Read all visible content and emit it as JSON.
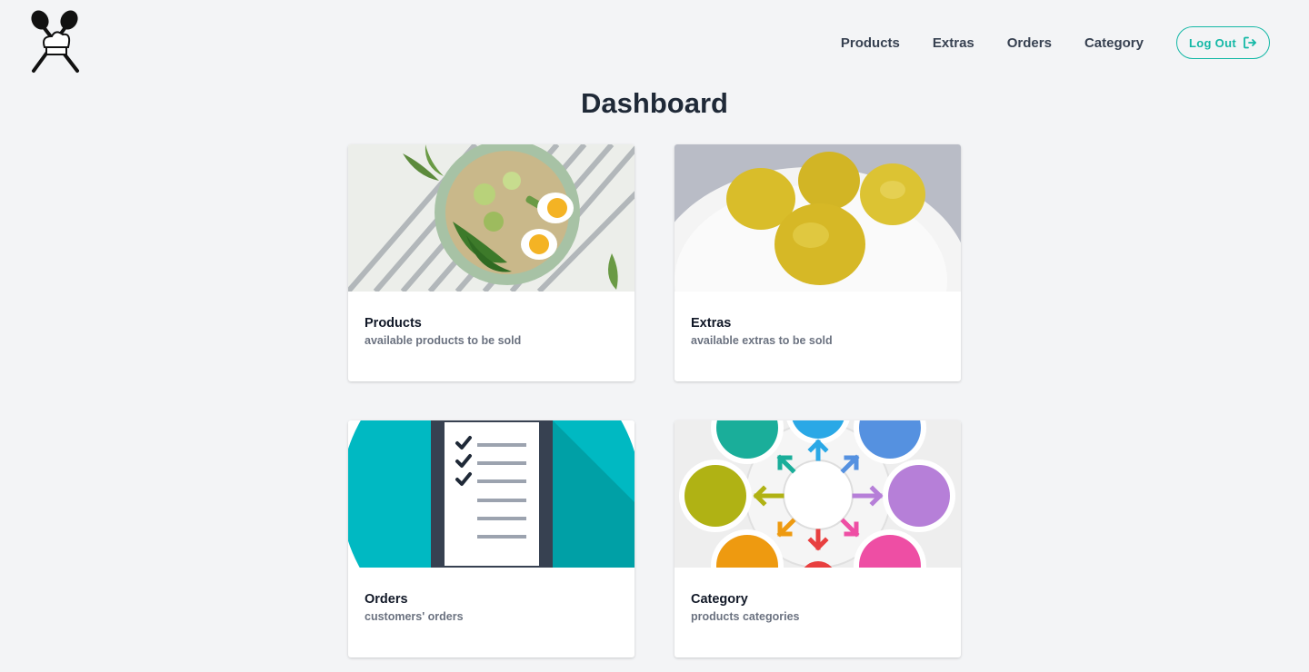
{
  "header": {
    "logo": "crossed-spoons-chef-hat-logo",
    "nav": [
      {
        "label": "Products"
      },
      {
        "label": "Extras"
      },
      {
        "label": "Orders"
      },
      {
        "label": "Category"
      }
    ],
    "logout": {
      "label": "Log Out",
      "icon": "logout-arrow-icon",
      "color": "#14b8a6"
    }
  },
  "main": {
    "title": "Dashboard",
    "cards": [
      {
        "title": "Products",
        "description": "available products to be sold",
        "image": "salad-bowl-with-eggs-photo"
      },
      {
        "title": "Extras",
        "description": "available extras to be sold",
        "image": "yellow-dumplings-on-plate-photo"
      },
      {
        "title": "Orders",
        "description": "customers' orders",
        "image": "checklist-clipboard-illustration"
      },
      {
        "title": "Category",
        "description": "products categories",
        "image": "colored-circles-with-arrows-illustration"
      }
    ]
  }
}
